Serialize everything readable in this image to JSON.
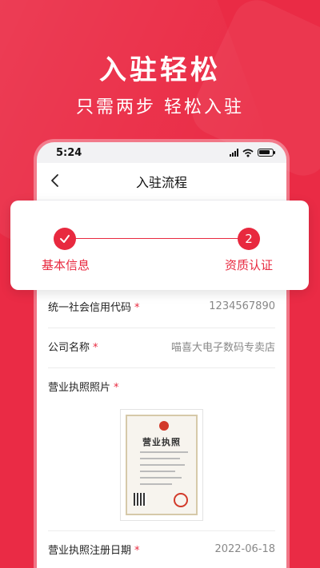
{
  "banner": {
    "headline": "入驻轻松",
    "subline": "只需两步  轻松入驻"
  },
  "status_bar": {
    "time": "5:24"
  },
  "nav": {
    "title": "入驻流程"
  },
  "steps": [
    {
      "label": "基本信息",
      "state": "done"
    },
    {
      "label": "资质认证",
      "number": "2",
      "state": "current"
    }
  ],
  "form": {
    "rows": [
      {
        "label": "统一社会信用代码",
        "required": "*",
        "value": "1234567890"
      },
      {
        "label": "公司名称",
        "required": "*",
        "value": "喵喜大电子数码专卖店"
      },
      {
        "label": "营业执照照片",
        "required": "*"
      },
      {
        "label": "营业执照注册日期",
        "required": "*",
        "value": "2022-06-18"
      }
    ],
    "license_title": "营业执照"
  },
  "colors": {
    "brand_red": "#ea2b45",
    "step_red": "#e8293f"
  }
}
